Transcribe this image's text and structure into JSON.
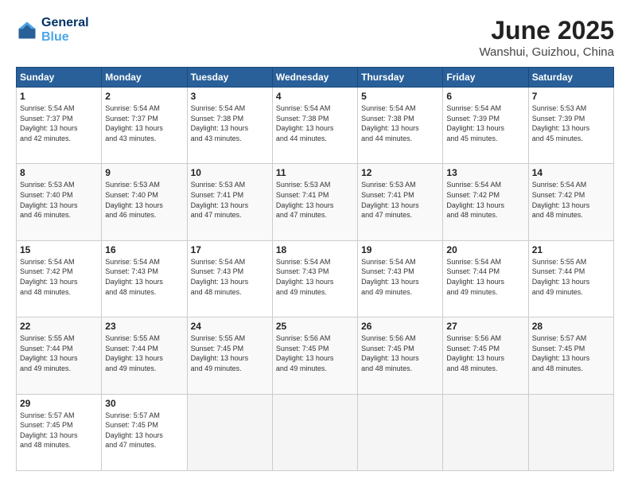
{
  "header": {
    "logo_line1": "General",
    "logo_line2": "Blue",
    "month_title": "June 2025",
    "subtitle": "Wanshui, Guizhou, China"
  },
  "weekdays": [
    "Sunday",
    "Monday",
    "Tuesday",
    "Wednesday",
    "Thursday",
    "Friday",
    "Saturday"
  ],
  "weeks": [
    [
      {
        "day": "1",
        "info": "Sunrise: 5:54 AM\nSunset: 7:37 PM\nDaylight: 13 hours\nand 42 minutes."
      },
      {
        "day": "2",
        "info": "Sunrise: 5:54 AM\nSunset: 7:37 PM\nDaylight: 13 hours\nand 43 minutes."
      },
      {
        "day": "3",
        "info": "Sunrise: 5:54 AM\nSunset: 7:38 PM\nDaylight: 13 hours\nand 43 minutes."
      },
      {
        "day": "4",
        "info": "Sunrise: 5:54 AM\nSunset: 7:38 PM\nDaylight: 13 hours\nand 44 minutes."
      },
      {
        "day": "5",
        "info": "Sunrise: 5:54 AM\nSunset: 7:38 PM\nDaylight: 13 hours\nand 44 minutes."
      },
      {
        "day": "6",
        "info": "Sunrise: 5:54 AM\nSunset: 7:39 PM\nDaylight: 13 hours\nand 45 minutes."
      },
      {
        "day": "7",
        "info": "Sunrise: 5:53 AM\nSunset: 7:39 PM\nDaylight: 13 hours\nand 45 minutes."
      }
    ],
    [
      {
        "day": "8",
        "info": "Sunrise: 5:53 AM\nSunset: 7:40 PM\nDaylight: 13 hours\nand 46 minutes."
      },
      {
        "day": "9",
        "info": "Sunrise: 5:53 AM\nSunset: 7:40 PM\nDaylight: 13 hours\nand 46 minutes."
      },
      {
        "day": "10",
        "info": "Sunrise: 5:53 AM\nSunset: 7:41 PM\nDaylight: 13 hours\nand 47 minutes."
      },
      {
        "day": "11",
        "info": "Sunrise: 5:53 AM\nSunset: 7:41 PM\nDaylight: 13 hours\nand 47 minutes."
      },
      {
        "day": "12",
        "info": "Sunrise: 5:53 AM\nSunset: 7:41 PM\nDaylight: 13 hours\nand 47 minutes."
      },
      {
        "day": "13",
        "info": "Sunrise: 5:54 AM\nSunset: 7:42 PM\nDaylight: 13 hours\nand 48 minutes."
      },
      {
        "day": "14",
        "info": "Sunrise: 5:54 AM\nSunset: 7:42 PM\nDaylight: 13 hours\nand 48 minutes."
      }
    ],
    [
      {
        "day": "15",
        "info": "Sunrise: 5:54 AM\nSunset: 7:42 PM\nDaylight: 13 hours\nand 48 minutes."
      },
      {
        "day": "16",
        "info": "Sunrise: 5:54 AM\nSunset: 7:43 PM\nDaylight: 13 hours\nand 48 minutes."
      },
      {
        "day": "17",
        "info": "Sunrise: 5:54 AM\nSunset: 7:43 PM\nDaylight: 13 hours\nand 48 minutes."
      },
      {
        "day": "18",
        "info": "Sunrise: 5:54 AM\nSunset: 7:43 PM\nDaylight: 13 hours\nand 49 minutes."
      },
      {
        "day": "19",
        "info": "Sunrise: 5:54 AM\nSunset: 7:43 PM\nDaylight: 13 hours\nand 49 minutes."
      },
      {
        "day": "20",
        "info": "Sunrise: 5:54 AM\nSunset: 7:44 PM\nDaylight: 13 hours\nand 49 minutes."
      },
      {
        "day": "21",
        "info": "Sunrise: 5:55 AM\nSunset: 7:44 PM\nDaylight: 13 hours\nand 49 minutes."
      }
    ],
    [
      {
        "day": "22",
        "info": "Sunrise: 5:55 AM\nSunset: 7:44 PM\nDaylight: 13 hours\nand 49 minutes."
      },
      {
        "day": "23",
        "info": "Sunrise: 5:55 AM\nSunset: 7:44 PM\nDaylight: 13 hours\nand 49 minutes."
      },
      {
        "day": "24",
        "info": "Sunrise: 5:55 AM\nSunset: 7:45 PM\nDaylight: 13 hours\nand 49 minutes."
      },
      {
        "day": "25",
        "info": "Sunrise: 5:56 AM\nSunset: 7:45 PM\nDaylight: 13 hours\nand 49 minutes."
      },
      {
        "day": "26",
        "info": "Sunrise: 5:56 AM\nSunset: 7:45 PM\nDaylight: 13 hours\nand 48 minutes."
      },
      {
        "day": "27",
        "info": "Sunrise: 5:56 AM\nSunset: 7:45 PM\nDaylight: 13 hours\nand 48 minutes."
      },
      {
        "day": "28",
        "info": "Sunrise: 5:57 AM\nSunset: 7:45 PM\nDaylight: 13 hours\nand 48 minutes."
      }
    ],
    [
      {
        "day": "29",
        "info": "Sunrise: 5:57 AM\nSunset: 7:45 PM\nDaylight: 13 hours\nand 48 minutes."
      },
      {
        "day": "30",
        "info": "Sunrise: 5:57 AM\nSunset: 7:45 PM\nDaylight: 13 hours\nand 47 minutes."
      },
      {
        "day": "",
        "info": ""
      },
      {
        "day": "",
        "info": ""
      },
      {
        "day": "",
        "info": ""
      },
      {
        "day": "",
        "info": ""
      },
      {
        "day": "",
        "info": ""
      }
    ]
  ]
}
